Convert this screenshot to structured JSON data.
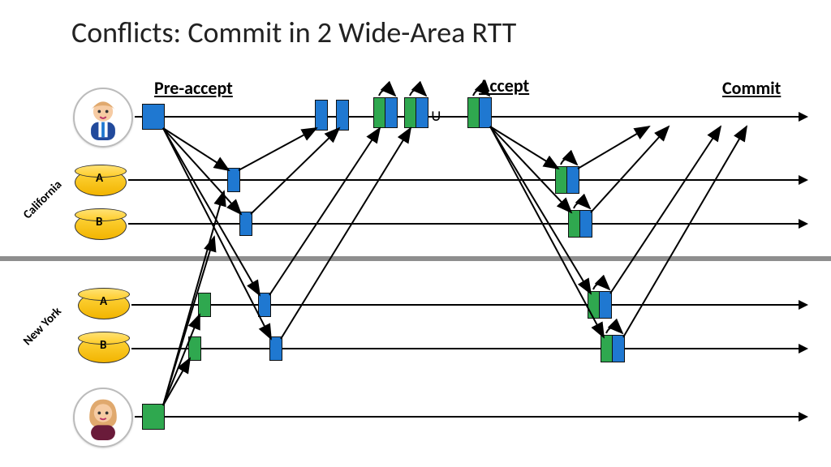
{
  "title": "Conflicts: Commit in 2 Wide-Area RTT",
  "phases": {
    "preaccept": "Pre-accept",
    "accept": "Accept",
    "commit": "Commit"
  },
  "regions": {
    "top": "California",
    "bottom": "New York"
  },
  "nodes": {
    "a": "A",
    "b": "B"
  },
  "symbols": {
    "union": "∪"
  },
  "tokens": {
    "client_top": "blue",
    "client_bottom": "green"
  }
}
